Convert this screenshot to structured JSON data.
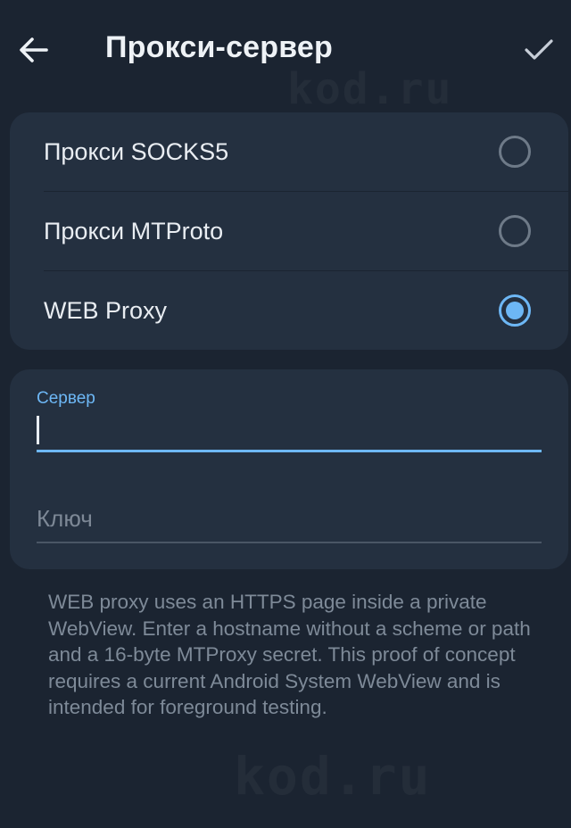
{
  "header": {
    "title": "Прокси-сервер",
    "back_icon": "arrow-left-icon",
    "confirm_icon": "checkmark-icon"
  },
  "proxy_types": [
    {
      "label": "Прокси SOCKS5",
      "selected": false
    },
    {
      "label": "Прокси MTProto",
      "selected": false
    },
    {
      "label": "WEB Proxy",
      "selected": true
    }
  ],
  "fields": {
    "server": {
      "label": "Сервер",
      "value": ""
    },
    "key": {
      "placeholder": "Ключ",
      "value": ""
    }
  },
  "info_text": "WEB proxy uses an HTTPS page inside a private WebView. Enter a hostname without a scheme or path and a 16-byte MTProxy secret. This proof of concept requires a current Android System WebView and is intended for foreground testing.",
  "watermark": "kod.ru",
  "colors": {
    "background": "#1b2431",
    "card": "#243040",
    "accent": "#6db7f5",
    "secondary_text": "#7e8a98"
  }
}
